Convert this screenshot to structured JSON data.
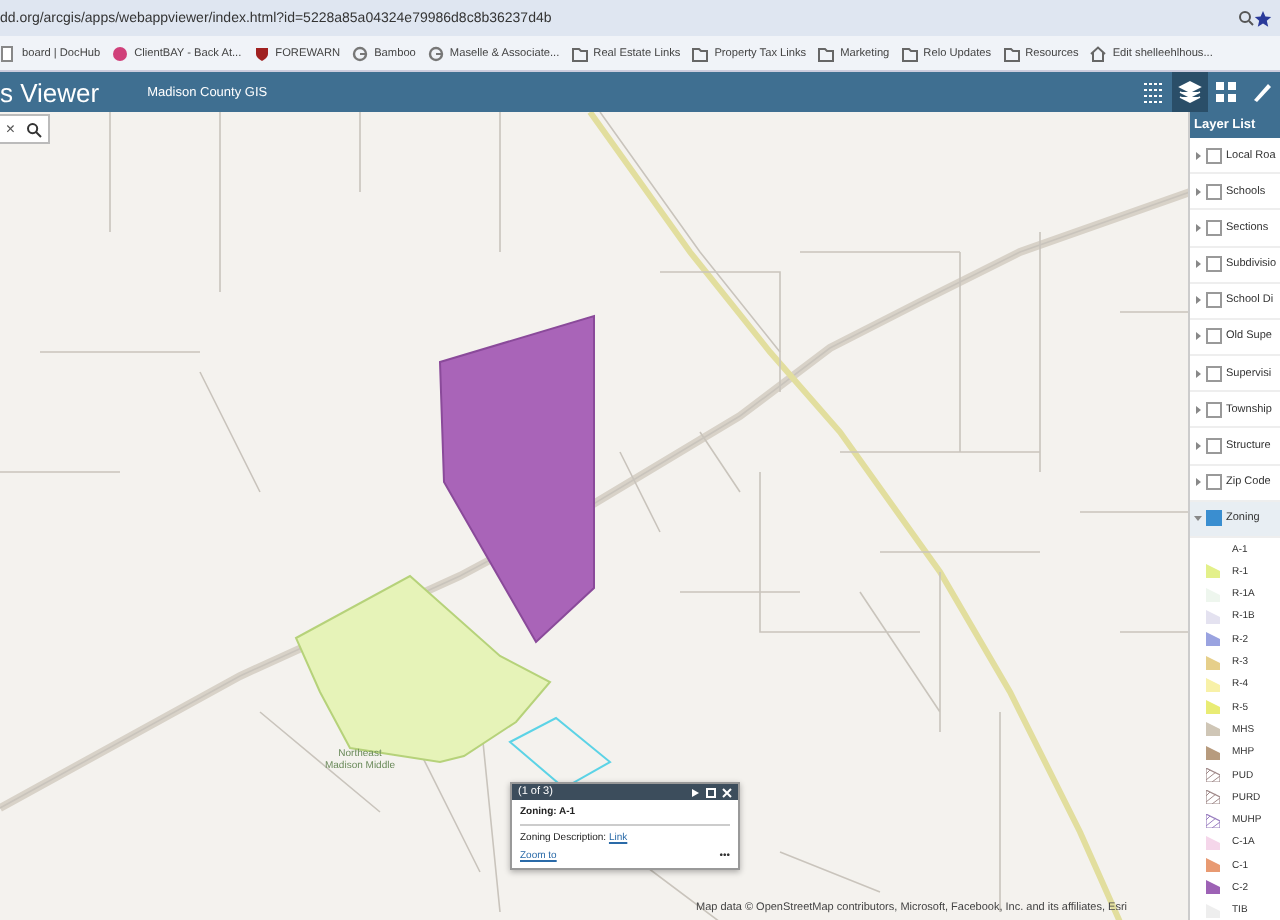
{
  "browser": {
    "url": "dd.org/arcgis/apps/webappviewer/index.html?id=5228a85a04324e79986d8c8b36237d4b",
    "bookmarks": [
      {
        "kind": "page",
        "label": "board | DocHub"
      },
      {
        "kind": "dot",
        "label": "ClientBAY - Back At..."
      },
      {
        "kind": "shield",
        "label": "FOREWARN"
      },
      {
        "kind": "g",
        "label": "Bamboo"
      },
      {
        "kind": "g",
        "label": "Maselle & Associate..."
      },
      {
        "kind": "folder",
        "label": "Real Estate Links"
      },
      {
        "kind": "folder",
        "label": "Property Tax Links"
      },
      {
        "kind": "folder",
        "label": "Marketing"
      },
      {
        "kind": "folder",
        "label": "Relo Updates"
      },
      {
        "kind": "folder",
        "label": "Resources"
      },
      {
        "kind": "home",
        "label": "Edit shelleehlhous..."
      }
    ]
  },
  "app": {
    "title": "s Viewer",
    "subtitle": "Madison County GIS",
    "tools": [
      {
        "kind": "list",
        "selected": false
      },
      {
        "kind": "layers",
        "selected": true
      },
      {
        "kind": "grid",
        "selected": false
      },
      {
        "kind": "pen",
        "selected": false
      }
    ]
  },
  "search": {
    "clear": "×"
  },
  "map": {
    "label": "Northeast Madison Middle",
    "attribution": "Map data © OpenStreetMap contributors, Microsoft, Facebook, Inc. and its affiliates, Esri"
  },
  "popup": {
    "counter": "(1 of 3)",
    "heading": "Zoning: A-1",
    "description_label": "Zoning Description:",
    "description_link": "Link",
    "zoom_link": "Zoom to",
    "more": "•••"
  },
  "layer_list": {
    "title": "Layer List",
    "layers": [
      {
        "label": "Local Roa",
        "checked": false,
        "expanded": false
      },
      {
        "label": "Schools",
        "checked": false,
        "expanded": false
      },
      {
        "label": "Sections",
        "checked": false,
        "expanded": false
      },
      {
        "label": "Subdivisio",
        "checked": false,
        "expanded": false
      },
      {
        "label": "School Di",
        "checked": false,
        "expanded": false
      },
      {
        "label": "Old Supe",
        "checked": false,
        "expanded": false
      },
      {
        "label": "Supervisi",
        "checked": false,
        "expanded": false
      },
      {
        "label": "Township",
        "checked": false,
        "expanded": false
      },
      {
        "label": "Structure",
        "checked": false,
        "expanded": false
      },
      {
        "label": "Zip Code",
        "checked": false,
        "expanded": false
      },
      {
        "label": "Zoning",
        "checked": true,
        "expanded": true,
        "legend": [
          {
            "label": "A-1",
            "kind": "none"
          },
          {
            "label": "R-1",
            "kind": "fill",
            "color": "#e3f08a"
          },
          {
            "label": "R-1A",
            "kind": "fill",
            "color": "#eef6ee"
          },
          {
            "label": "R-1B",
            "kind": "fill",
            "color": "#e4e2f0"
          },
          {
            "label": "R-2",
            "kind": "fill",
            "color": "#9aa3e0"
          },
          {
            "label": "R-3",
            "kind": "fill",
            "color": "#e6cf8a"
          },
          {
            "label": "R-4",
            "kind": "fill",
            "color": "#f8f1a8"
          },
          {
            "label": "R-5",
            "kind": "fill",
            "color": "#e9ec74"
          },
          {
            "label": "MHS",
            "kind": "fill",
            "color": "#cfc6b6"
          },
          {
            "label": "MHP",
            "kind": "fill",
            "color": "#b79b7e"
          },
          {
            "label": "PUD",
            "kind": "hatch",
            "color": "#a08a8a"
          },
          {
            "label": "PURD",
            "kind": "hatch",
            "color": "#a08a8a"
          },
          {
            "label": "MUHP",
            "kind": "hatch",
            "color": "#9a7fc0"
          },
          {
            "label": "C-1A",
            "kind": "fill",
            "color": "#f5d6ea"
          },
          {
            "label": "C-1",
            "kind": "fill",
            "color": "#e89a72"
          },
          {
            "label": "C-2",
            "kind": "fill",
            "color": "#9d62b5"
          },
          {
            "label": "TIB",
            "kind": "fill",
            "color": "#eeeeee"
          }
        ]
      }
    ]
  }
}
